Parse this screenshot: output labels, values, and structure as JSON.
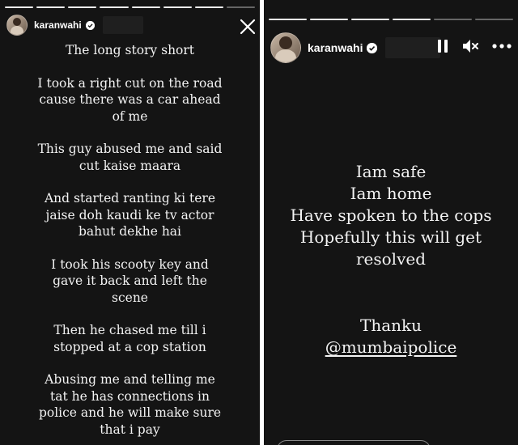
{
  "left_story": {
    "username": "karanwahi",
    "paragraphs": [
      "The long story short",
      "I took a right cut on the road\ncause there was a car ahead\nof me",
      "This guy abused me and said\ncut kaise maara",
      "And started ranting ki tere\njaise doh kaudi ke tv actor\nbahut dekhe hai",
      "I took his scooty key and\ngave it back and left the\nscene",
      "Then he chased me till i\nstopped at a cop station",
      "Abusing me and telling me\ntat he has connections in\npolice and he will make sure\nthat i pay"
    ],
    "close_icon": "close-icon"
  },
  "right_story": {
    "username": "karanwahi",
    "lines": [
      "Iam safe",
      "Iam home",
      "Have spoken to the cops",
      "Hopefully this will get",
      "resolved"
    ],
    "thanks": "Thanku",
    "mention": "@mumbaipolice",
    "controls": {
      "pause_icon": "pause-icon",
      "mute_icon": "mute-icon",
      "more_icon": "more-options-icon"
    }
  },
  "colors": {
    "background": "#141414",
    "text": "#f3f3f3",
    "verified_badge": "#ffffff"
  }
}
